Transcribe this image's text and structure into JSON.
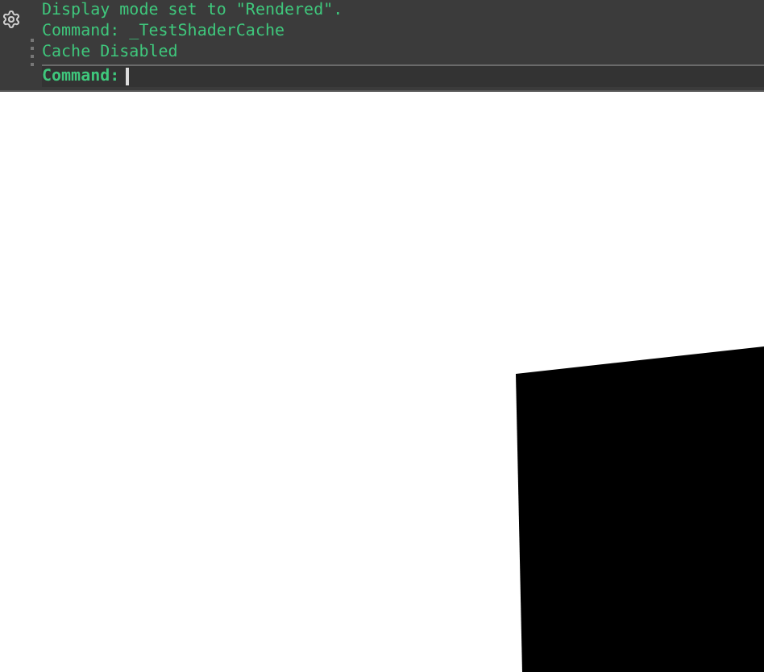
{
  "command_history": {
    "lines": [
      "Display mode set to \"Rendered\".",
      "Command: _TestShaderCache",
      "Cache Disabled"
    ]
  },
  "command_prompt": {
    "label": "Command:"
  }
}
